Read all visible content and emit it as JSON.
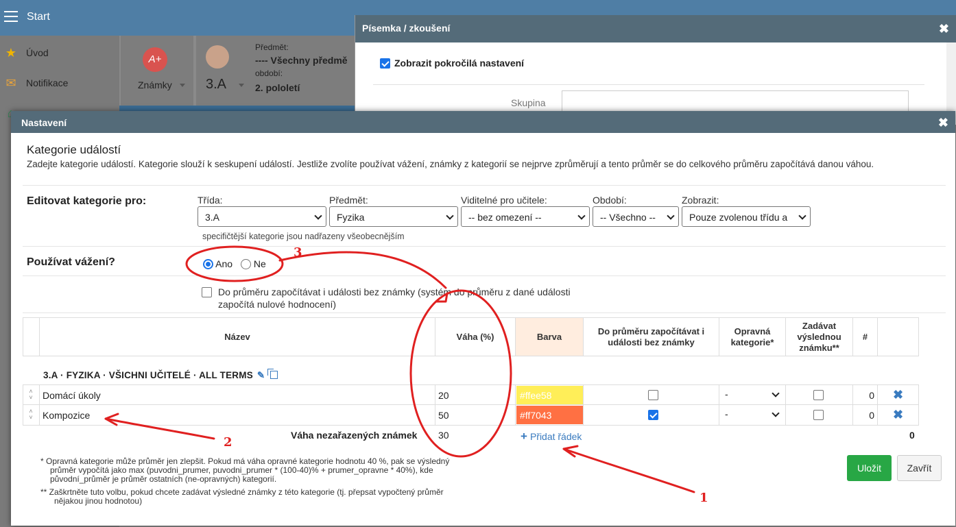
{
  "app": {
    "start_label": "Start",
    "sidebar": [
      {
        "icon": "star-icon",
        "label": "Úvod",
        "glyph": "★",
        "color": "#f0b400"
      },
      {
        "icon": "envelope-icon",
        "label": "Notifikace",
        "glyph": "✉",
        "color": "#e6a23c"
      },
      {
        "icon": "home-icon",
        "label": "",
        "glyph": "⌂",
        "color": "#2e8b57"
      }
    ],
    "toolbar": {
      "grades_label": "Známky",
      "grades_badge": "A+",
      "class_label": "3.A",
      "subject_caption": "Předmět:",
      "subject_value": "---- Všechny předmě",
      "period_caption": "období:",
      "period_value": "2. pololetí"
    }
  },
  "back_modal": {
    "title": "Písemka / zkoušení",
    "advanced_label": "Zobrazit pokročilá nastavení",
    "group_label": "Skupina"
  },
  "modal": {
    "title": "Nastavení",
    "heading": "Kategorie událostí",
    "description": "Zadejte kategorie událostí. Kategorie slouží k seskupení událostí. Jestliže zvolíte používat vážení, známky z kategorií se nejprve zprůměrují a tento průměr se do celkového průměru započítává danou váhou.",
    "edit_label": "Editovat kategorie pro:",
    "filters": {
      "class": {
        "label": "Třída:",
        "value": "3.A"
      },
      "subject": {
        "label": "Předmět:",
        "value": "Fyzika"
      },
      "teacher": {
        "label": "Viditelné pro učitele:",
        "value": "-- bez omezení --"
      },
      "period": {
        "label": "Období:",
        "value": "-- Všechno --"
      },
      "show": {
        "label": "Zobrazit:",
        "value": "Pouze zvolenou třídu a"
      }
    },
    "hint": "specifičtější kategorie jsou nadřazeny všeobecnějším",
    "weight_label": "Používat vážení?",
    "weight_yes": "Ano",
    "weight_no": "Ne",
    "zero_option": "Do průměru započítávat i události bez známky (systém do průměru z dané události započítá nulové hodnocení)",
    "table": {
      "headers": {
        "name": "Název",
        "weight": "Váha (%)",
        "color": "Barva",
        "count_no_grade": "Do průměru započítávat i události bez známky",
        "corrective": "Opravná kategorie*",
        "final_grade": "Zadávat výslednou známku**",
        "count": "#"
      },
      "group_title": "3.A · FYZIKA · VŠICHNI UČITELÉ · ALL TERMS",
      "rows": [
        {
          "name": "Domácí úkoly",
          "weight": "20",
          "color": "#ffee58",
          "color_label": "#ffee58",
          "count_no_grade": false,
          "corrective": "-",
          "final": false,
          "count": "0"
        },
        {
          "name": "Kompozice",
          "weight": "50",
          "color": "#ff7043",
          "color_label": "#ff7043",
          "count_no_grade": true,
          "corrective": "-",
          "final": false,
          "count": "0"
        }
      ],
      "unassigned_label": "Váha nezařazených známek",
      "unassigned_value": "30",
      "add_row": "Přidat řádek",
      "total_count": "0"
    },
    "note1": "* Opravná kategorie může průměr jen zlepšit. Pokud má váha opravné kategorie hodnotu 40 %, pak se výsledný průměr vypočítá jako max (puvodni_prumer, puvodni_prumer * (100-40)% + prumer_opravne * 40%), kde původní_průměr je průměr ostatních (ne-opravných) kategorií.",
    "note2": "** Zaškrtněte tuto volbu, pokud chcete zadávat výsledné známky z této kategorie (tj. přepsat vypočtený průměr nějakou jinou hodnotou)",
    "save_label": "Uložit",
    "close_label": "Zavřít"
  },
  "annotations": {
    "one": "1",
    "two": "2",
    "three": "3",
    "color": "#e02020"
  }
}
